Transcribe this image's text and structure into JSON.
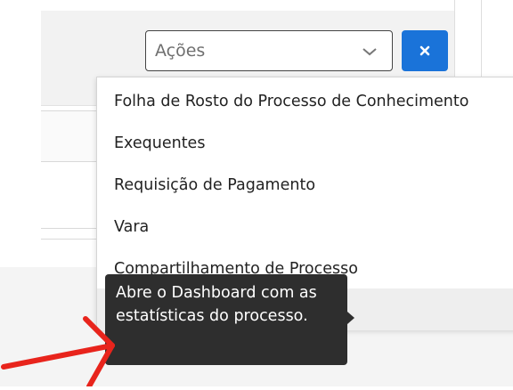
{
  "actions_select": {
    "selected_label": "Ações",
    "icon": "chevron-down-icon"
  },
  "clear_button": {
    "icon": "close-icon",
    "color": "#1a73d9"
  },
  "menu": {
    "items": [
      {
        "label": "Folha de Rosto do Processo de Conhecimento"
      },
      {
        "label": "Exequentes"
      },
      {
        "label": "Requisição de Pagamento"
      },
      {
        "label": "Vara"
      },
      {
        "label": "Compartilhamento de Processo"
      },
      {
        "label": ""
      }
    ]
  },
  "tooltip": {
    "text": "Abre o Dashboard com as estatísticas do processo."
  },
  "annotation": {
    "icon": "red-arrow-icon",
    "color": "#e8241c"
  }
}
